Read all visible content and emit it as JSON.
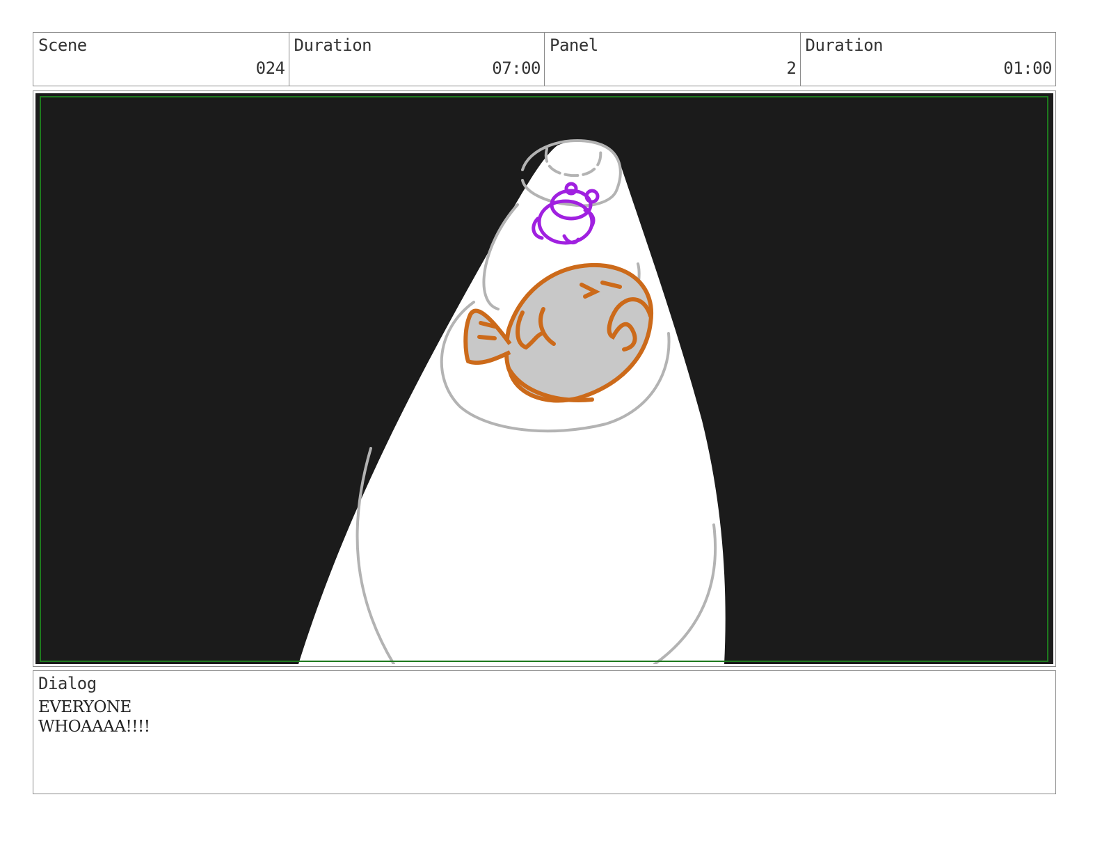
{
  "header": {
    "cells": [
      {
        "label": "Scene",
        "value": "024"
      },
      {
        "label": "Duration",
        "value": "07:00"
      },
      {
        "label": "Panel",
        "value": "2"
      },
      {
        "label": "Duration",
        "value": "01:00"
      }
    ]
  },
  "panel_image": {
    "background_color": "#1b1b1b",
    "safe_frame_color": "#1e7a1e",
    "sketch_line_color": "#b3b3b3",
    "fish_color": "#cc6a1a",
    "fish_fill": "#c8c8c8",
    "small_character_color": "#a020e0",
    "icons": [
      "spotlight-beam",
      "fish-sketch",
      "small-character-sketch"
    ]
  },
  "dialog": {
    "label": "Dialog",
    "lines": [
      "EVERYONE",
      "WHOAAAA!!!!"
    ]
  }
}
